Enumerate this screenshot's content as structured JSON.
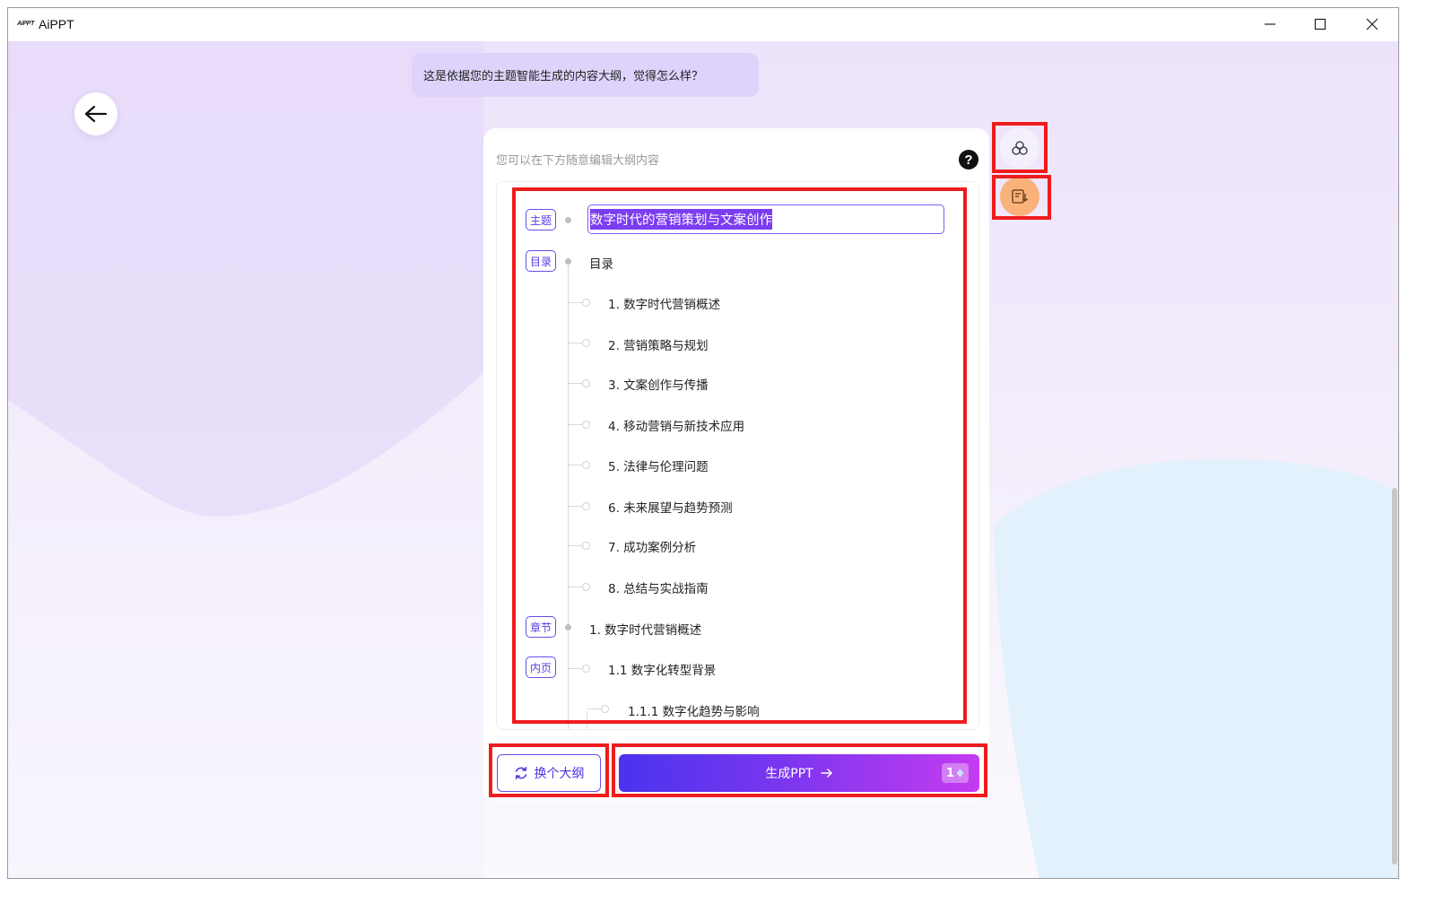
{
  "window": {
    "app_logo": "AiPPT",
    "title": "AiPPT",
    "controls": [
      "minimize-icon",
      "maximize-icon",
      "close-icon"
    ]
  },
  "assistant_message": "这是依据您的主题智能生成的内容大纲，觉得怎么样？",
  "editor": {
    "hint": "您可以在下方随意编辑大纲内容",
    "help_icon": "?",
    "topic_tag": "主题",
    "topic_value": "数字时代的营销策划与文案创作",
    "toc_tag": "目录",
    "toc_label": "目录",
    "toc_items": [
      "1. 数字时代营销概述",
      "2. 营销策略与规划",
      "3. 文案创作与传播",
      "4. 移动营销与新技术应用",
      "5. 法律与伦理问题",
      "6. 未来展望与趋势预测",
      "7. 成功案例分析",
      "8. 总结与实战指南"
    ],
    "chapter_tag": "章节",
    "chapter_label": "1. 数字时代营销概述",
    "page_tag": "内页",
    "page_label": "1.1 数字化转型背景",
    "sub_label": "1.1.1 数字化趋势与影响"
  },
  "side_tools": {
    "template_icon": "template-icon",
    "export_icon": "export-outline-icon"
  },
  "actions": {
    "change_outline": "换个大纲",
    "generate": "生成PPT",
    "credit_count": "1"
  },
  "colors": {
    "accent": "#6b4ce6",
    "highlight_box": "#ee1c1c",
    "bubble": "#ddd3fb",
    "export_button": "#f9b27a"
  }
}
